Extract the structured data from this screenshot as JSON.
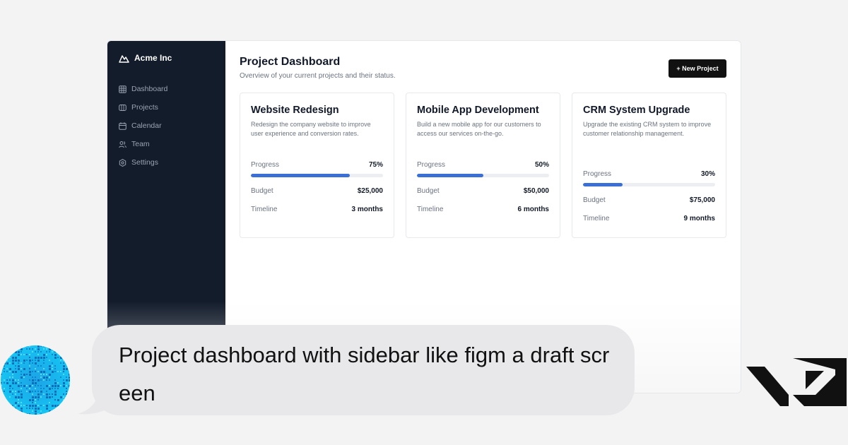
{
  "sidebar": {
    "brand": "Acme Inc",
    "items": [
      {
        "label": "Dashboard",
        "icon": "grid-icon"
      },
      {
        "label": "Projects",
        "icon": "columns-icon"
      },
      {
        "label": "Calendar",
        "icon": "calendar-icon"
      },
      {
        "label": "Team",
        "icon": "users-icon"
      },
      {
        "label": "Settings",
        "icon": "gear-icon"
      }
    ]
  },
  "header": {
    "title": "Project Dashboard",
    "subtitle": "Overview of your current projects and their status.",
    "new_button": "+ New Project"
  },
  "labels": {
    "progress": "Progress",
    "budget": "Budget",
    "timeline": "Timeline"
  },
  "projects": [
    {
      "title": "Website Redesign",
      "description": "Redesign the company website to improve user experience and conversion rates.",
      "progress": 75,
      "progress_label": "75%",
      "budget": "$25,000",
      "timeline": "3 months"
    },
    {
      "title": "Mobile App Development",
      "description": "Build a new mobile app for our customers to access our services on-the-go.",
      "progress": 50,
      "progress_label": "50%",
      "budget": "$50,000",
      "timeline": "6 months"
    },
    {
      "title": "CRM System Upgrade",
      "description": "Upgrade the existing CRM system to improve customer relationship management.",
      "progress": 30,
      "progress_label": "30%",
      "budget": "$75,000",
      "timeline": "9 months"
    }
  ],
  "chat": {
    "message": "Project dashboard with sidebar like figm a draft screen"
  },
  "colors": {
    "sidebar_bg": "#131c2b",
    "accent": "#3b6fd6",
    "button_bg": "#111111"
  }
}
